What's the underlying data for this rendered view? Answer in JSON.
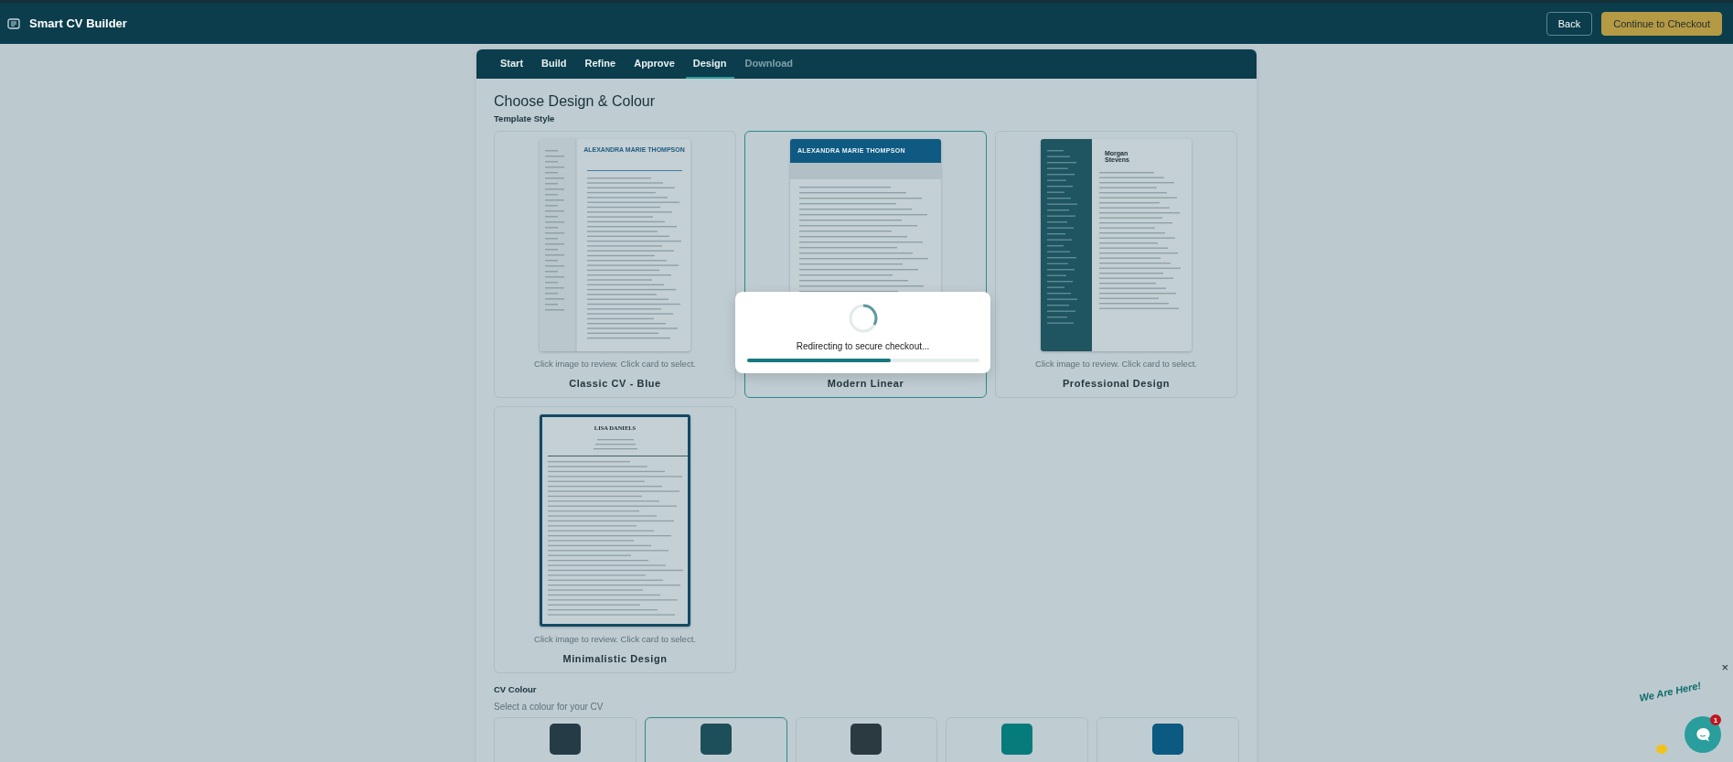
{
  "app": {
    "title": "Smart CV Builder",
    "buttons": [
      {
        "label": "Back",
        "kind": "outline"
      },
      {
        "label": "Continue to Checkout",
        "kind": "primary"
      }
    ]
  },
  "tabs": [
    {
      "label": "Start",
      "selected": false,
      "disabled": false
    },
    {
      "label": "Build",
      "selected": false,
      "disabled": false
    },
    {
      "label": "Refine",
      "selected": false,
      "disabled": false
    },
    {
      "label": "Approve",
      "selected": false,
      "disabled": false
    },
    {
      "label": "Design",
      "selected": true,
      "disabled": false
    },
    {
      "label": "Download",
      "selected": false,
      "disabled": true
    }
  ],
  "heading": "Choose Design & Colour",
  "template_section": {
    "label": "Template Style",
    "templates": [
      {
        "name": "Classic CV - Blue",
        "kind": "classic",
        "preview_name": "ALEXANDRA MARIE THOMPSON",
        "hint": "Click image to review. Click card to select.",
        "selected": false
      },
      {
        "name": "Modern Linear",
        "kind": "modern",
        "preview_name": "ALEXANDRA MARIE THOMPSON",
        "selected": true
      },
      {
        "name": "Professional Design",
        "kind": "professional",
        "preview_name": "Morgan Stevens",
        "hint": "Click image to review. Click card to select.",
        "selected": false
      },
      {
        "name": "Minimalistic Design",
        "kind": "minimal",
        "preview_name": "LISA DANIELS",
        "hint": "Click image to review. Click card to select.",
        "selected": false
      }
    ]
  },
  "colour_section": {
    "label": "CV Colour",
    "hint": "Select a colour for your CV",
    "colours": [
      {
        "color": "#253c47",
        "selected": false
      },
      {
        "color": "#1d4f5a",
        "selected": true
      },
      {
        "color": "#2b3a41",
        "selected": false
      },
      {
        "color": "#057b7c",
        "selected": false
      },
      {
        "color": "#0a5a82",
        "selected": false
      }
    ]
  },
  "modal": {
    "message": "Redirecting to secure checkout...",
    "level": 0.62
  },
  "chat_widget": {
    "caption": "We Are Here!",
    "badge": "1",
    "close": "×"
  }
}
